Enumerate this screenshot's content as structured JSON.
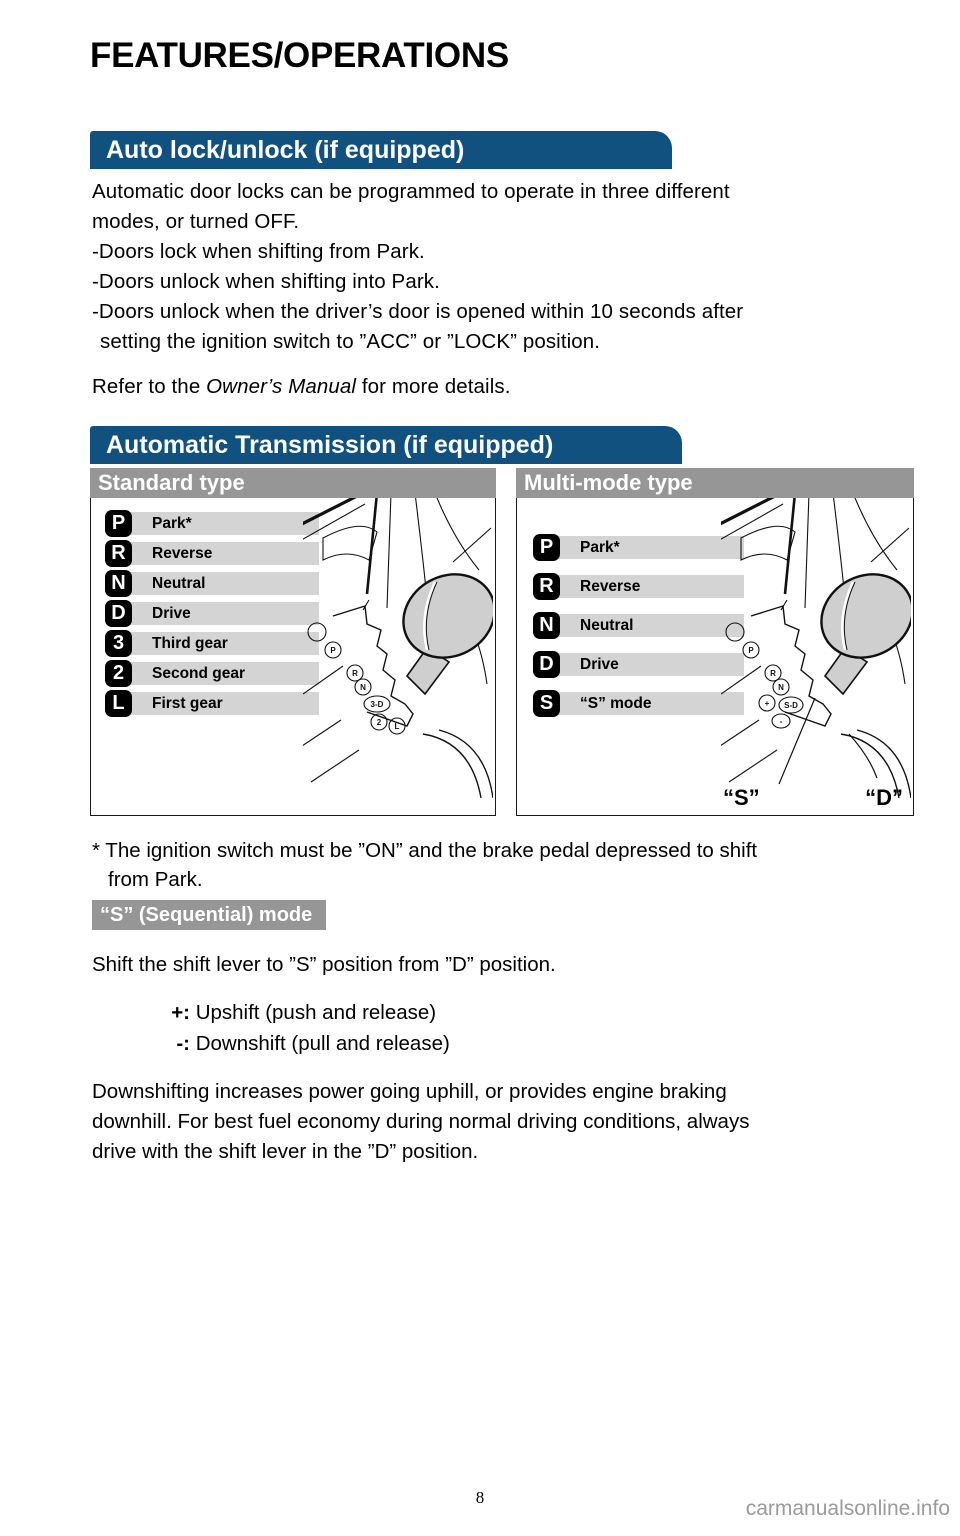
{
  "page": {
    "title": "FEATURES/OPERATIONS",
    "number": "8",
    "watermark": "carmanualsonline.info"
  },
  "colors": {
    "header_blue": "#10517f",
    "subheader_gray": "#969696",
    "label_gray": "#d4d4d4",
    "badge_black": "#000000",
    "watermark_gray": "#9a9a9a"
  },
  "sections": {
    "auto_lock": {
      "heading": "Auto lock/unlock (if equipped)",
      "intro_line1": "Automatic door locks can be programmed to operate in three different",
      "intro_line2": "modes, or turned OFF.",
      "bullets": [
        "-Doors lock when shifting from Park.",
        "-Doors unlock when shifting into Park.",
        "-Doors unlock when the driver’s door is opened within 10 seconds after"
      ],
      "bullet3_continuation": "setting the ignition switch to ”ACC” or ”LOCK” position.",
      "refer_prefix": "Refer to the ",
      "refer_italic": "Owner’s Manual",
      "refer_suffix": " for more details."
    },
    "auto_transmission": {
      "heading": "Automatic Transmission (if equipped)",
      "standard": {
        "panel_title": "Standard type",
        "gears": [
          {
            "badge": "P",
            "label": "Park*"
          },
          {
            "badge": "R",
            "label": "Reverse"
          },
          {
            "badge": "N",
            "label": "Neutral"
          },
          {
            "badge": "D",
            "label": "Drive"
          },
          {
            "badge": "3",
            "label": "Third gear"
          },
          {
            "badge": "2",
            "label": "Second gear"
          },
          {
            "badge": "L",
            "label": "First gear"
          }
        ],
        "gate_markings": [
          "P",
          "R",
          "N",
          "3-D",
          "2",
          "L"
        ]
      },
      "multi_mode": {
        "panel_title": "Multi-mode type",
        "gears": [
          {
            "badge": "P",
            "label": "Park*"
          },
          {
            "badge": "R",
            "label": "Reverse"
          },
          {
            "badge": "N",
            "label": "Neutral"
          },
          {
            "badge": "D",
            "label": "Drive"
          },
          {
            "badge": "S",
            "label": "“S” mode"
          }
        ],
        "gate_markings": [
          "P",
          "R",
          "N",
          "+",
          "S-D",
          "-"
        ],
        "callout_left": "“S”",
        "callout_right": "“D”"
      },
      "footnote_line1": "* The ignition switch must be ”ON” and the brake pedal depressed to shift",
      "footnote_line2": "from Park."
    },
    "sequential_mode": {
      "heading": "“S” (Sequential) mode",
      "intro": "Shift the shift lever to ”S” position from ”D” position.",
      "operations": [
        {
          "symbol": "+:",
          "text": "Upshift (push and release)"
        },
        {
          "symbol": "-:",
          "text": "Downshift (pull and release)"
        }
      ],
      "body_line1": "Downshifting increases power going uphill, or provides engine braking",
      "body_line2": "downhill. For best fuel economy during normal driving conditions, always",
      "body_line3": "drive with the shift lever in the ”D” position."
    }
  }
}
